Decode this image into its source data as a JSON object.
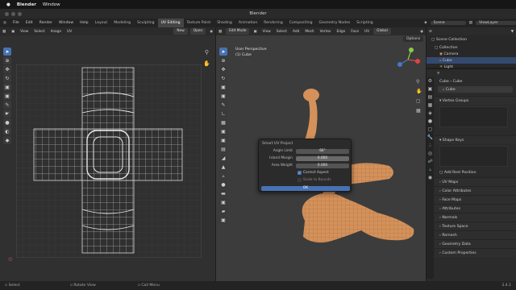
{
  "mac_menu": {
    "apple": "",
    "app": "Blender",
    "window": "Window"
  },
  "title": "Blender",
  "topbar": {
    "menus": [
      "File",
      "Edit",
      "Render",
      "Window",
      "Help"
    ],
    "workspaces": [
      "Layout",
      "Modeling",
      "Sculpting",
      "UV Editing",
      "Texture Paint",
      "Shading",
      "Animation",
      "Rendering",
      "Compositing",
      "Geometry Nodes",
      "Scripting"
    ],
    "active_workspace": "UV Editing",
    "scene": "Scene",
    "view_layer": "ViewLayer"
  },
  "uv_header": {
    "menus": [
      "View",
      "Select",
      "Image",
      "UV"
    ],
    "new": "New",
    "open": "Open"
  },
  "vp_header": {
    "mode": "Edit Mode",
    "menus": [
      "View",
      "Select",
      "Add",
      "Mesh",
      "Vertex",
      "Edge",
      "Face",
      "UV"
    ],
    "transform": "Global",
    "options": "Options"
  },
  "viewport": {
    "line1": "User Perspective",
    "line2": "(1) Cube"
  },
  "dialog": {
    "title": "Smart UV Project",
    "angle_label": "Angle Limit",
    "angle_value": "66°",
    "margin_label": "Island Margin",
    "margin_value": "0.000",
    "area_label": "Area Weight",
    "area_value": "0.000",
    "correct_aspect": "Correct Aspect",
    "scale_bounds": "Scale to Bounds",
    "ok": "OK"
  },
  "outliner": {
    "collection_root": "Scene Collection",
    "collection": "Collection",
    "items": [
      "Camera",
      "Cube",
      "Light"
    ]
  },
  "properties": {
    "crumb_a": "Cube",
    "crumb_b": "Cube",
    "mesh_name": "Cube",
    "vertex_groups": "Vertex Groups",
    "shape_keys": "Shape Keys",
    "add_rest": "Add Rest Position",
    "sections": [
      "UV Maps",
      "Color Attributes",
      "Face Maps",
      "Attributes",
      "Normals",
      "Texture Space",
      "Remesh",
      "Geometry Data",
      "Custom Properties"
    ]
  },
  "status": {
    "select": "Select",
    "rotate": "Rotate View",
    "call_menu": "Call Menu",
    "version": "3.4.1"
  },
  "colors": {
    "accent": "#4772b3",
    "mesh": "#d4915a",
    "bg_uv": "#303030",
    "bg_vp": "#3c3c3c"
  }
}
